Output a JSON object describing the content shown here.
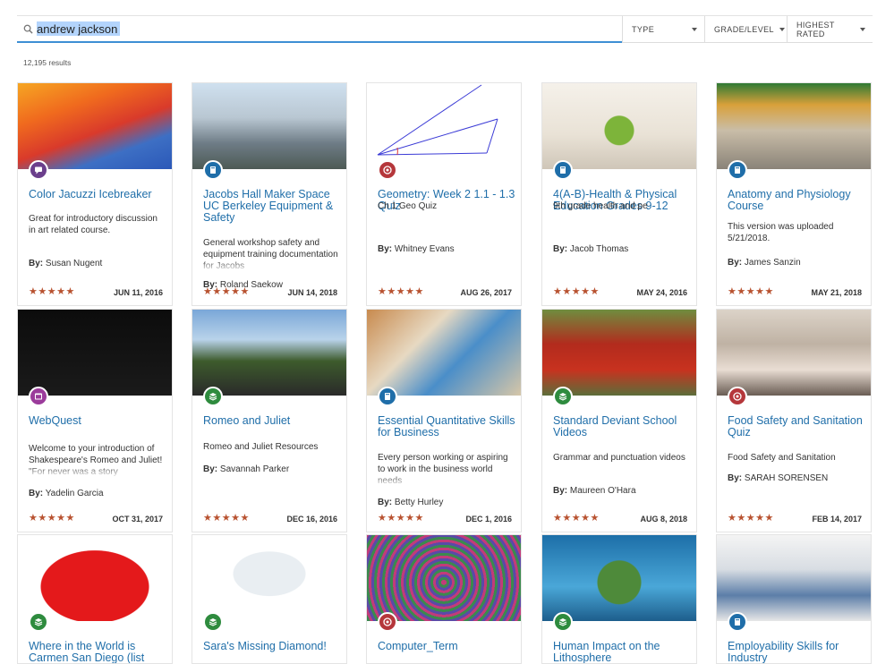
{
  "search": {
    "value": "andrew jackson"
  },
  "filters": {
    "type": "TYPE",
    "grade": "GRADE/LEVEL",
    "rating": "HIGHEST RATED"
  },
  "results_count": "12,195 results",
  "colors": {
    "accent": "#3d8fd4",
    "title": "#1f6ea9",
    "stars": "#b85230",
    "badge_purple": "#6b3f8c",
    "badge_blue": "#1f6ea9",
    "badge_red": "#b5373b",
    "badge_green": "#2e8b3e",
    "badge_magenta": "#9b3b9b"
  },
  "cards": [
    {
      "title": "Color Jacuzzi Icebreaker",
      "desc": "Great for introductory discussion in art related course.",
      "by": "By:",
      "author": "Susan Nugent",
      "stars": "★★★★★",
      "date": "JUN 11, 2016",
      "badge_icon": "chat-icon",
      "badge": "badge_purple"
    },
    {
      "title": "Jacobs Hall Maker Space UC Berkeley Equipment & Safety",
      "desc": "General workshop safety and equipment training documentation for Jacobs",
      "by": "By:",
      "author": "Roland Saekow",
      "stars": "★★★★★",
      "date": "JUN 14, 2018",
      "badge_icon": "book-icon",
      "badge": "badge_blue"
    },
    {
      "title": "Geometry: Week 2 1.1 - 1.3 Quiz",
      "desc": "Ch 1 Geo Quiz",
      "by": "By:",
      "author": "Whitney Evans",
      "stars": "★★★★★",
      "date": "AUG 26, 2017",
      "badge_icon": "target-icon",
      "badge": "badge_red"
    },
    {
      "title": "4(A-B)-Health & Physical Education Grades 9-12",
      "desc": "9th grade health and pe",
      "by": "By:",
      "author": "Jacob Thomas",
      "stars": "★★★★★",
      "date": "MAY 24, 2016",
      "badge_icon": "book-icon",
      "badge": "badge_blue"
    },
    {
      "title": "Anatomy and Physiology Course",
      "desc": "This version was uploaded 5/21/2018.",
      "by": "By:",
      "author": "James Sanzin",
      "stars": "★★★★★",
      "date": "MAY 21, 2018",
      "badge_icon": "book-icon",
      "badge": "badge_blue"
    },
    {
      "title": "WebQuest",
      "desc": "Welcome to your introduction of Shakespeare's Romeo and Juliet! \"For never was a story",
      "by": "By:",
      "author": "Yadelin Garcia",
      "stars": "★★★★★",
      "date": "OCT 31, 2017",
      "badge_icon": "web-icon",
      "badge": "badge_magenta"
    },
    {
      "title": "Romeo and Juliet",
      "desc": "Romeo and Juliet Resources",
      "by": "By:",
      "author": "Savannah Parker",
      "stars": "★★★★★",
      "date": "DEC 16, 2016",
      "badge_icon": "stack-icon",
      "badge": "badge_green"
    },
    {
      "title": "Essential Quantitative Skills for Business",
      "desc": "Every person working or aspiring to work in the business world needs",
      "by": "By:",
      "author": "Betty Hurley",
      "stars": "★★★★★",
      "date": "DEC 1, 2016",
      "badge_icon": "book-icon",
      "badge": "badge_blue"
    },
    {
      "title": "Standard Deviant School Videos",
      "desc": "Grammar and punctuation videos",
      "by": "By:",
      "author": "Maureen O'Hara",
      "stars": "★★★★★",
      "date": "AUG 8, 2018",
      "badge_icon": "stack-icon",
      "badge": "badge_green"
    },
    {
      "title": "Food Safety and Sanitation Quiz",
      "desc": "Food Safety and Sanitation",
      "by": "By:",
      "author": "SARAH SORENSEN",
      "stars": "★★★★★",
      "date": "FEB 14, 2017",
      "badge_icon": "target-icon",
      "badge": "badge_red"
    },
    {
      "title": "Where in the World is Carmen San Diego (list",
      "desc": "",
      "by": "",
      "author": "",
      "stars": "",
      "date": "",
      "badge_icon": "stack-icon",
      "badge": "badge_green"
    },
    {
      "title": "Sara's Missing Diamond!",
      "desc": "",
      "by": "",
      "author": "",
      "stars": "",
      "date": "",
      "badge_icon": "stack-icon",
      "badge": "badge_green"
    },
    {
      "title": "Computer_Term",
      "desc": "",
      "by": "",
      "author": "",
      "stars": "",
      "date": "",
      "badge_icon": "target-icon",
      "badge": "badge_red"
    },
    {
      "title": "Human Impact on the Lithosphere",
      "desc": "",
      "by": "",
      "author": "",
      "stars": "",
      "date": "",
      "badge_icon": "stack-icon",
      "badge": "badge_green"
    },
    {
      "title": "Employability Skills for Industry",
      "desc": "",
      "by": "",
      "author": "",
      "stars": "",
      "date": "",
      "badge_icon": "book-icon",
      "badge": "badge_blue"
    }
  ]
}
